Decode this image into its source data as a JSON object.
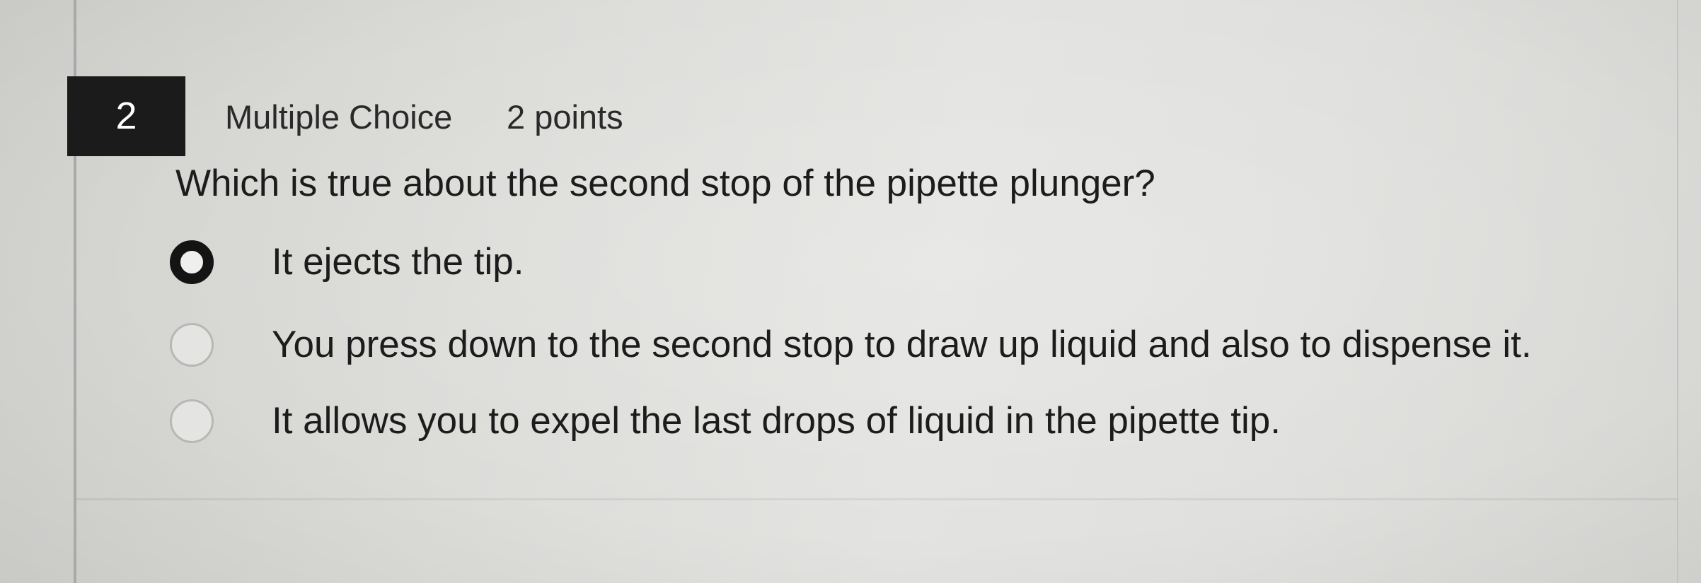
{
  "question": {
    "number": "2",
    "type": "Multiple Choice",
    "points": "2 points",
    "text": "Which is true about the second stop of the pipette plunger?"
  },
  "options": [
    {
      "label": "It ejects the tip.",
      "selected": true,
      "icon": "radio-selected-icon"
    },
    {
      "label": "You press down to the second stop to draw up liquid and also to dispense it.",
      "selected": false,
      "icon": "radio-unselected-icon"
    },
    {
      "label": "It allows you to expel the last drops of liquid in the pipette tip.",
      "selected": false,
      "icon": "radio-unselected-icon"
    }
  ],
  "colors": {
    "number_badge_bg": "#1b1b1b",
    "number_badge_text": "#ffffff",
    "text": "#1c1c1c",
    "radio_selected": "#141414",
    "radio_unselected_border": "#b7b7b4"
  }
}
